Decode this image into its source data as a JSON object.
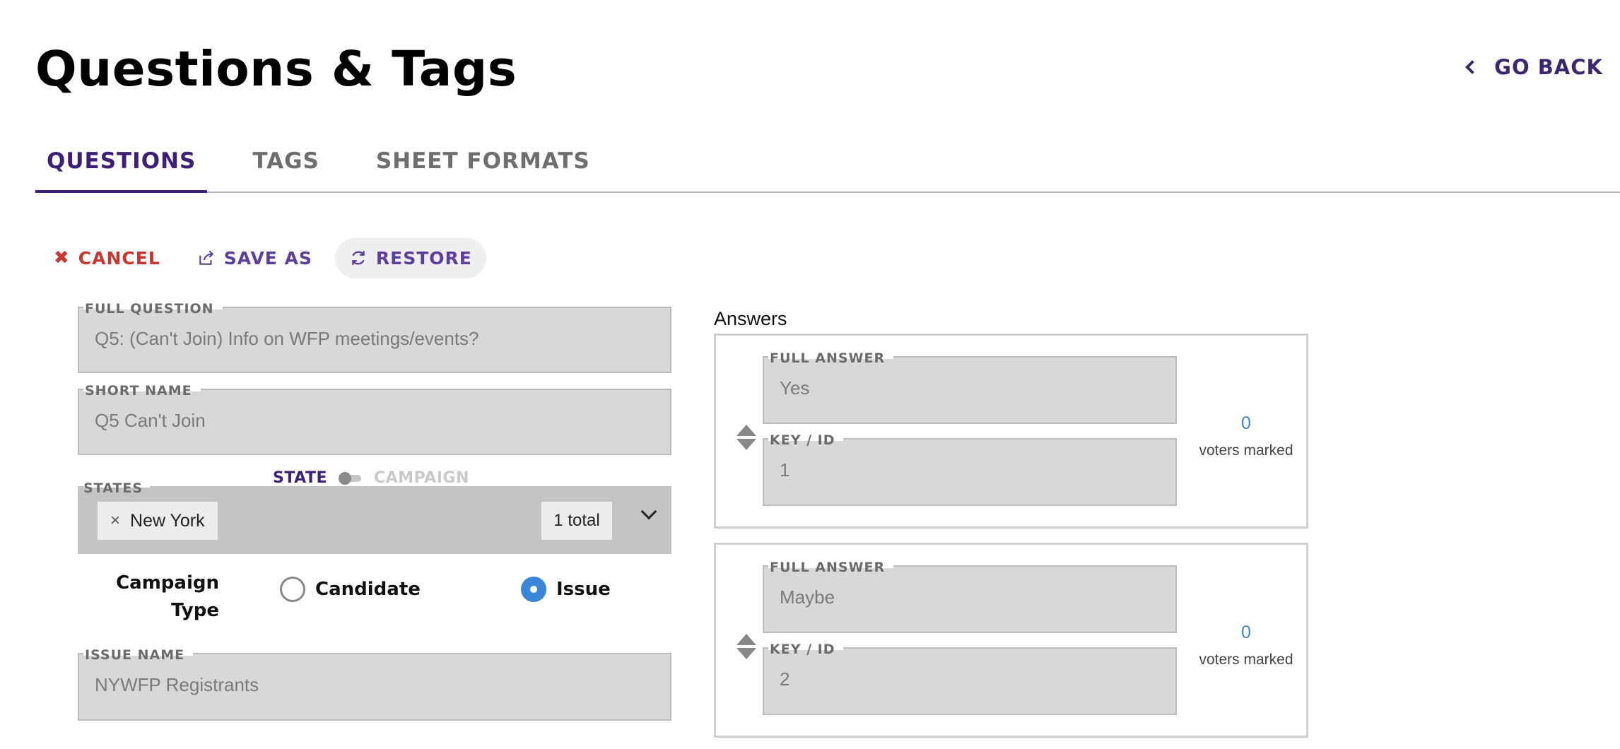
{
  "header": {
    "title": "Questions & Tags",
    "go_back": "GO BACK"
  },
  "tabs": [
    {
      "label": "QUESTIONS",
      "active": true
    },
    {
      "label": "TAGS",
      "active": false
    },
    {
      "label": "SHEET FORMATS",
      "active": false
    }
  ],
  "actions": {
    "cancel": "CANCEL",
    "save_as": "SAVE AS",
    "restore": "RESTORE"
  },
  "form": {
    "full_question": {
      "label": "FULL QUESTION",
      "value": "Q5:  (Can't Join) Info on WFP meetings/events?"
    },
    "short_name": {
      "label": "SHORT NAME",
      "value": "Q5 Can't Join"
    },
    "scope_toggle": {
      "left": "STATE",
      "right": "CAMPAIGN",
      "selected": "STATE"
    },
    "states": {
      "label": "STATES",
      "selected": [
        "New York"
      ],
      "total": "1 total",
      "remove_symbol": "×"
    },
    "campaign_type": {
      "label": "Campaign Type",
      "options": [
        "Candidate",
        "Issue"
      ],
      "selected": "Issue"
    },
    "issue_name": {
      "label": "ISSUE NAME",
      "value": "NYWFP Registrants"
    }
  },
  "answers": {
    "title": "Answers",
    "items": [
      {
        "full_answer_label": "FULL ANSWER",
        "full_answer": "Yes",
        "key_label": "KEY / ID",
        "key": "1",
        "voters_count": "0",
        "voters_label": "voters marked"
      },
      {
        "full_answer_label": "FULL ANSWER",
        "full_answer": "Maybe",
        "key_label": "KEY / ID",
        "key": "2",
        "voters_count": "0",
        "voters_label": "voters marked"
      }
    ]
  },
  "colors": {
    "accent_purple": "#3d1f78",
    "cancel_red": "#c8362e",
    "radio_blue": "#3a86d8",
    "field_bg": "#d8d8d8"
  },
  "icons": {
    "cancel": "close-icon",
    "save_as": "share-out-icon",
    "restore": "refresh-icon",
    "go_back": "chevron-left-icon",
    "states_dropdown": "chevron-down-icon",
    "answer_reorder": "sort-arrows-icon"
  }
}
